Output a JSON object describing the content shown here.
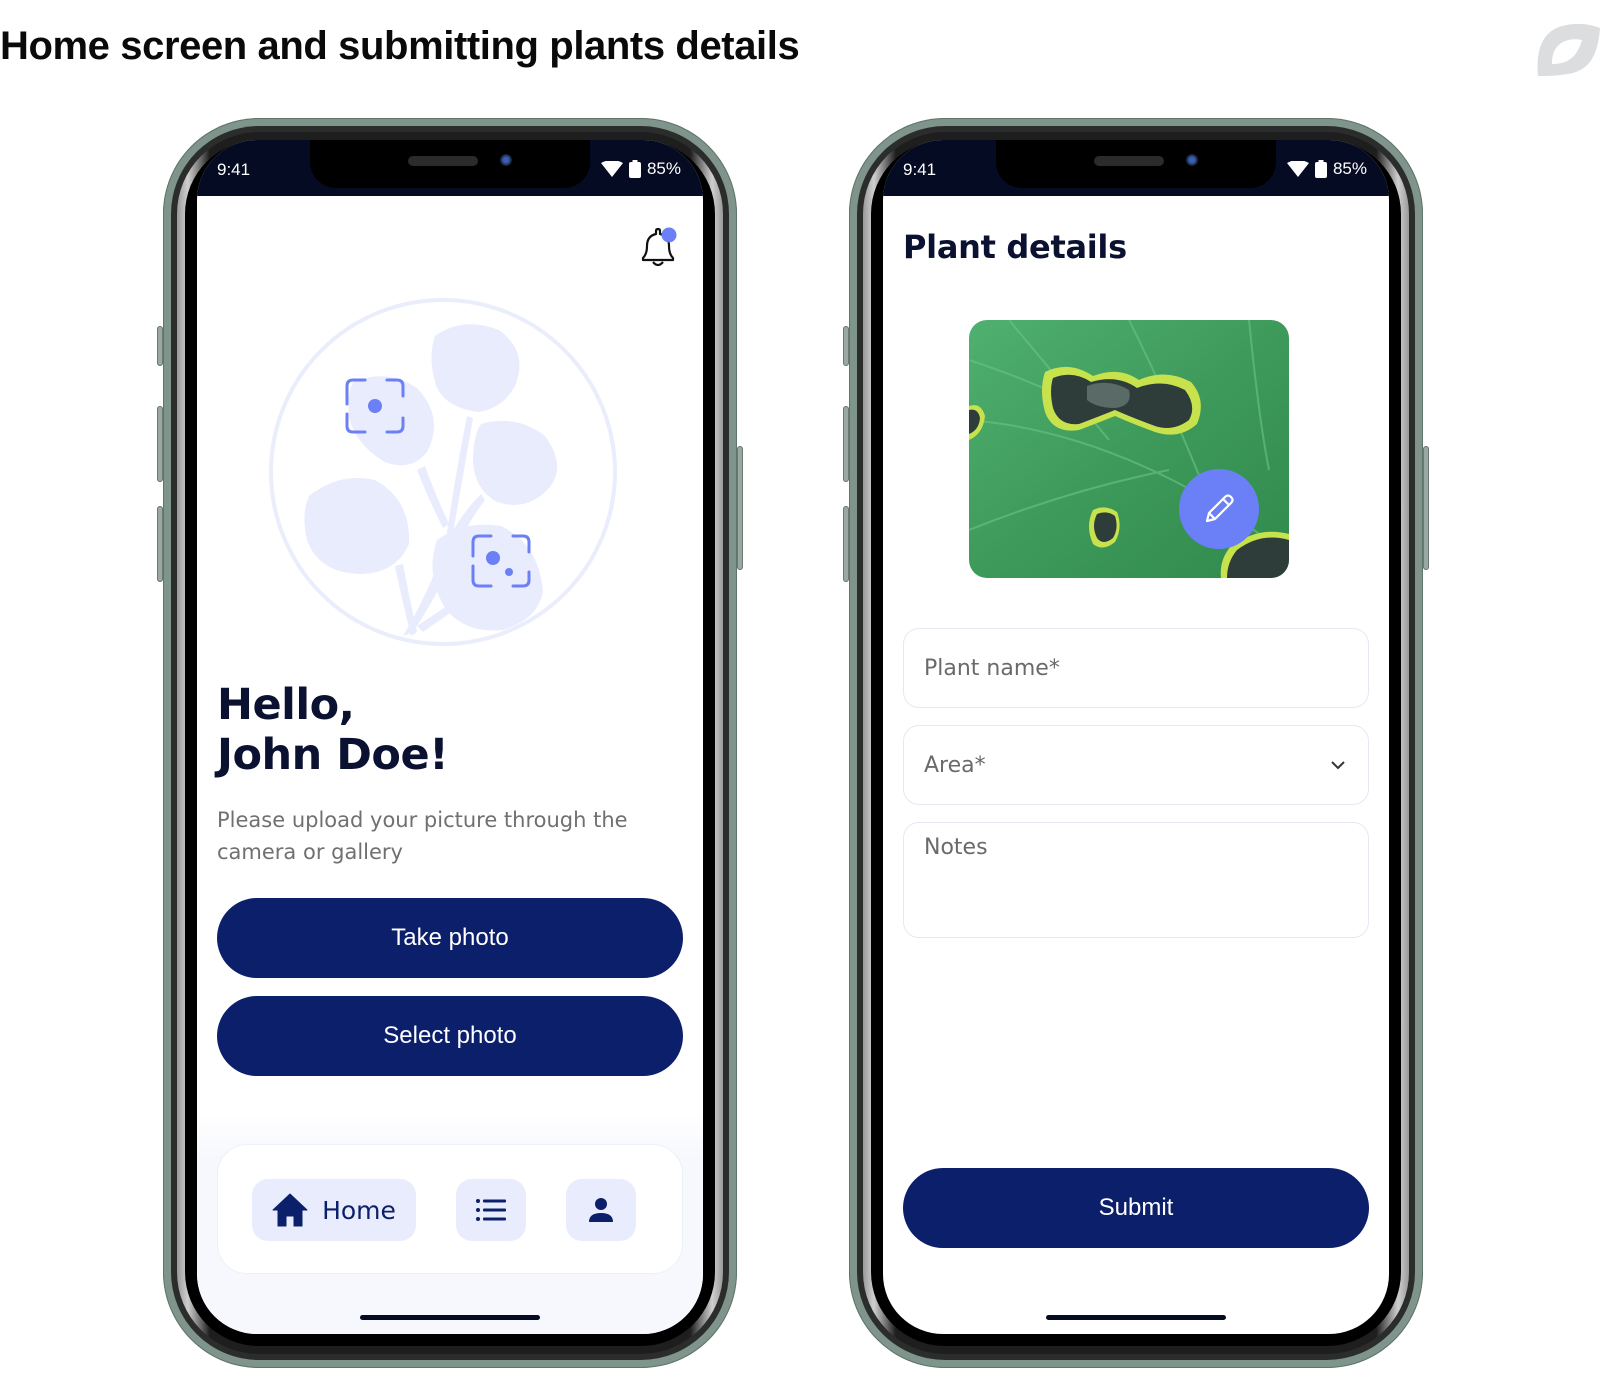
{
  "page": {
    "title": "Home screen and submitting plants details",
    "brand_logo_icon": "leaf-logo-icon"
  },
  "status_bar": {
    "time": "9:41",
    "battery": "85%",
    "icons": [
      "wifi-icon",
      "battery-icon"
    ]
  },
  "home_screen": {
    "notification_icon": "bell-icon",
    "has_unread_notification": true,
    "greeting_line1": "Hello,",
    "greeting_line2": "John Doe!",
    "subtitle": "Please upload your picture through the camera or gallery",
    "take_photo_label": "Take photo",
    "select_photo_label": "Select photo",
    "tabbar": {
      "items": [
        {
          "icon": "home-icon",
          "label": "Home",
          "active": true
        },
        {
          "icon": "list-icon",
          "label": "",
          "active": false
        },
        {
          "icon": "profile-icon",
          "label": "",
          "active": false
        }
      ]
    }
  },
  "plant_details_screen": {
    "title": "Plant details",
    "photo": "diseased-leaf-photo",
    "edit_icon": "pencil-icon",
    "fields": {
      "plant_name": {
        "value": "",
        "placeholder": "Plant name*"
      },
      "area": {
        "value": "",
        "placeholder": "Area*"
      },
      "notes": {
        "value": "",
        "placeholder": "Notes"
      }
    },
    "submit_label": "Submit"
  },
  "colors": {
    "primary": "#0b1f6b",
    "accent": "#6b80f7",
    "tint": "#e9ecfd",
    "status_bar": "#050b22",
    "frame": "#7f958c"
  }
}
